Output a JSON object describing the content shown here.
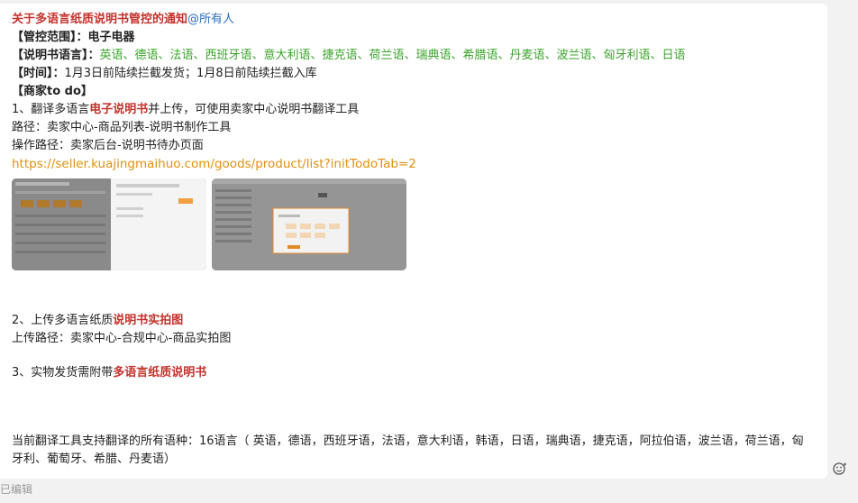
{
  "message": {
    "title": "关于多语言纸质说明书管控的通知",
    "mention": "@所有人",
    "scope_label": "【管控范围】：",
    "scope_value": "电子电器",
    "languages_label": "【说明书语言】：",
    "languages_value": "英语、德语、法语、西班牙语、意大利语、捷克语、荷兰语、瑞典语、希腊语、丹麦语、波兰语、匈牙利语、日语",
    "time_label": "【时间】：",
    "time_value": "1月3日前陆续拦截发货；1月8日前陆续拦截入库",
    "todo_label": "【商家to do】",
    "step1_prefix": "1、翻译多语言",
    "step1_highlight": "电子说明书",
    "step1_suffix": "并上传，可使用卖家中心说明书翻译工具",
    "path1": "路径：卖家中心-商品列表-说明书制作工具",
    "path2": "操作路径：卖家后台-说明书待办页面",
    "link": "https://seller.kuajingmaihuo.com/goods/product/list?initTodoTab=2",
    "step2_prefix": "2、上传多语言纸质",
    "step2_highlight": "说明书实拍图",
    "upload_path": "上传路径：卖家中心-合规中心-商品实拍图",
    "step3_prefix": "3、实物发货需附带",
    "step3_highlight": "多语言纸质说明书",
    "support_text": "当前翻译工具支持翻译的所有语种：16语言（ 英语，德语，西班牙语，法语，意大利语，韩语，日语，瑞典语，捷克语，阿拉伯语，波兰语，荷兰语，匈牙利、葡萄牙、希腊、丹麦语）"
  },
  "footer": {
    "edited": "已编辑"
  },
  "icons": {
    "reaction": "emoji-reaction-icon"
  },
  "colors": {
    "highlight_red": "#c4322c",
    "language_green": "#3aa32a",
    "mention_blue": "#2e6fbf",
    "link_orange": "#e0900f"
  }
}
